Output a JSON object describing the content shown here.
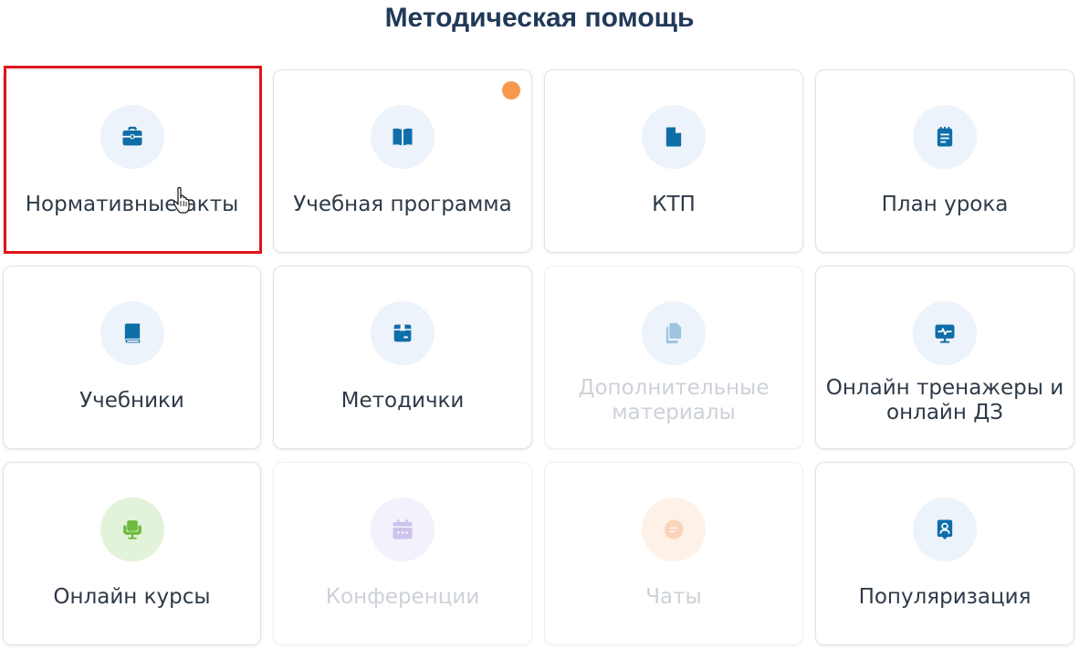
{
  "page": {
    "title": "Методическая помощь"
  },
  "colors": {
    "title": "#21395a",
    "icon_blue": "#0f6ea8",
    "icon_green": "#6dbb3f",
    "badge": "#f6994f",
    "highlight": "#e0141c"
  },
  "cards": [
    {
      "label": "Нормативные акты",
      "icon": "briefcase-icon",
      "state": "active",
      "highlighted": true
    },
    {
      "label": "Учебная программа",
      "icon": "open-book-icon",
      "state": "active",
      "notification_dot": true
    },
    {
      "label": "КТП",
      "icon": "document-icon",
      "state": "active"
    },
    {
      "label": "План урока",
      "icon": "notepad-icon",
      "state": "active"
    },
    {
      "label": "Учебники",
      "icon": "book-icon",
      "state": "active"
    },
    {
      "label": "Методички",
      "icon": "box-icon",
      "state": "active"
    },
    {
      "label": "Дополнительные материалы",
      "icon": "copy-documents-icon",
      "state": "disabled"
    },
    {
      "label": "Онлайн тренажеры и онлайн ДЗ",
      "icon": "monitor-pulse-icon",
      "state": "active"
    },
    {
      "label": "Онлайн курсы",
      "icon": "chair-icon",
      "state": "active"
    },
    {
      "label": "Конференции",
      "icon": "calendar-icon",
      "state": "disabled"
    },
    {
      "label": "Чаты",
      "icon": "chat-bubble-icon",
      "state": "disabled"
    },
    {
      "label": "Популяризация",
      "icon": "profile-badge-icon",
      "state": "active"
    }
  ]
}
